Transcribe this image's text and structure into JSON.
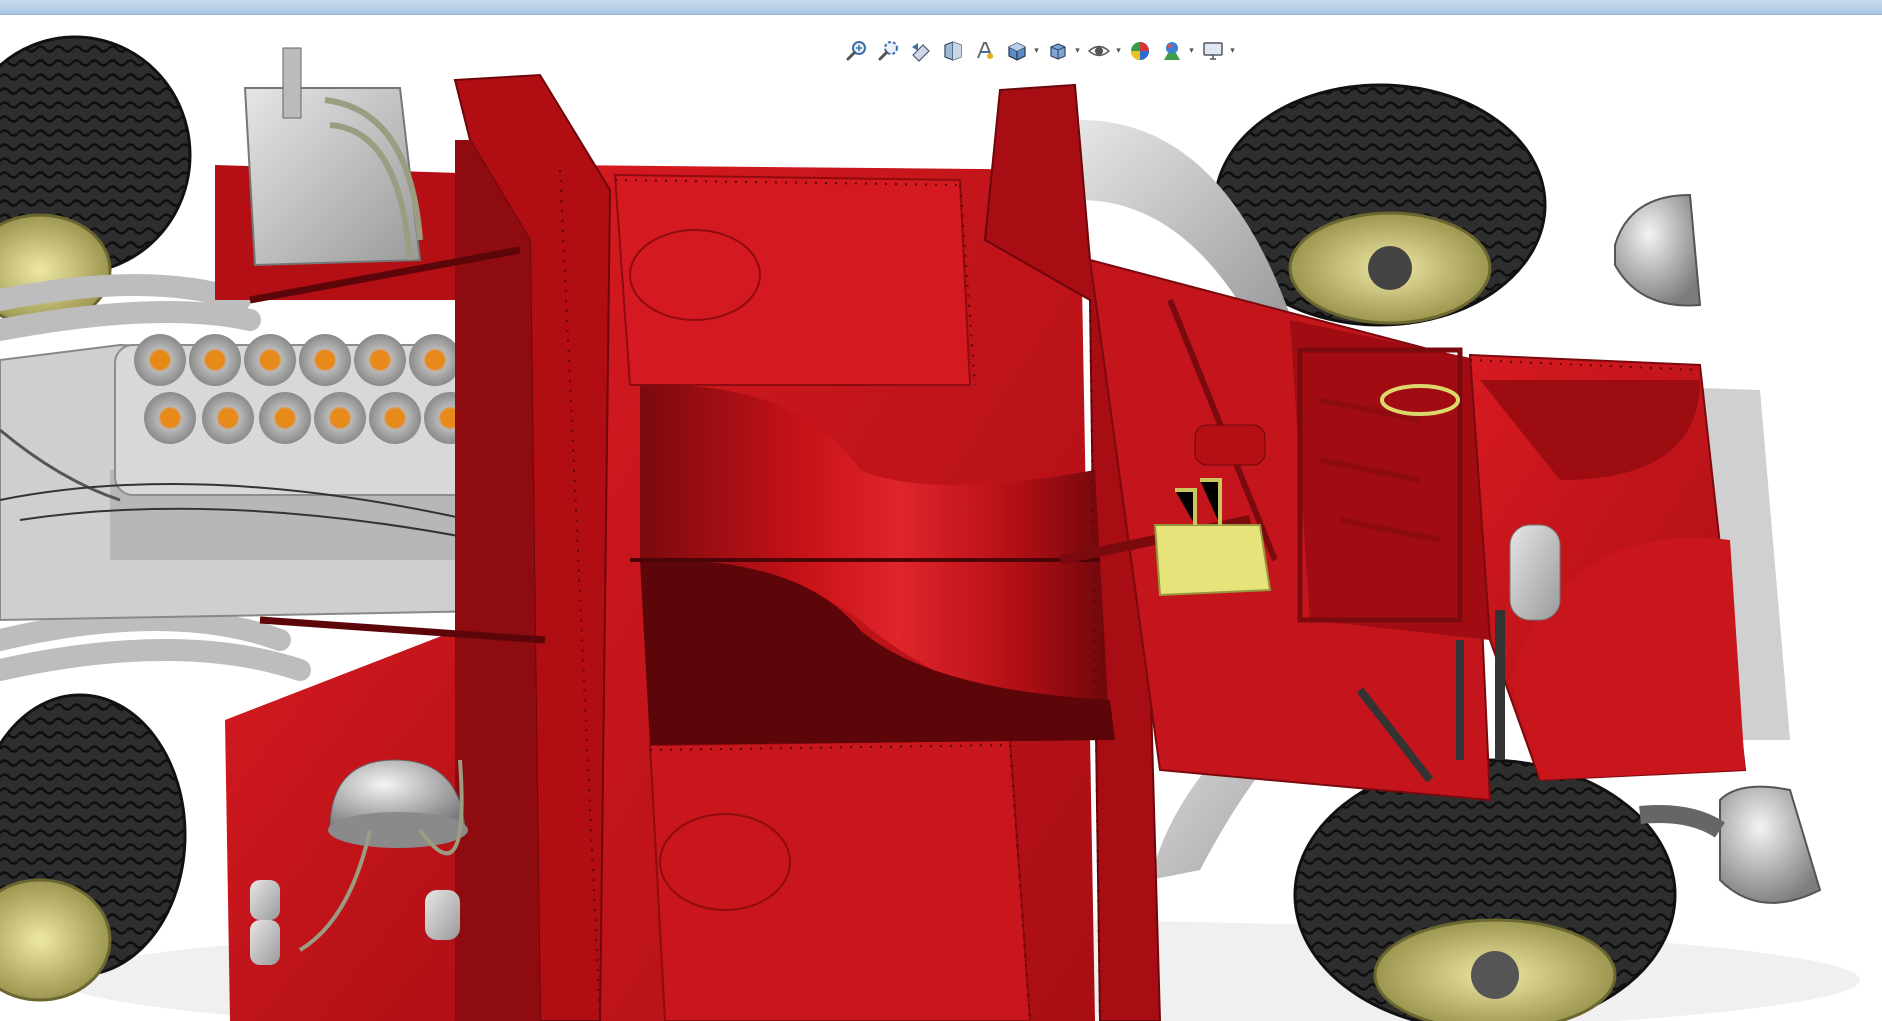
{
  "app": {
    "accent": "#a9c6e4",
    "viewport_background": "#ffffff"
  },
  "model": {
    "chassis_color": "#c8141a",
    "chassis_shadow": "#7a0a0e",
    "tire_color": "#2b2b2b",
    "rim_color": "#d9d58a",
    "engine_color": "#c9c9c9",
    "intake_color": "#e88a1a",
    "relay_color": "#e6e37a"
  },
  "toolbar": {
    "buttons": [
      {
        "icon": "zoom-to-fit-icon"
      },
      {
        "icon": "zoom-to-area-icon"
      },
      {
        "icon": "previous-view-icon"
      },
      {
        "icon": "section-view-icon"
      },
      {
        "icon": "dynamic-annotation-icon"
      },
      {
        "icon": "view-orientation-icon",
        "dropdown": true
      },
      {
        "icon": "display-style-icon",
        "dropdown": true
      },
      {
        "icon": "hide-show-items-icon",
        "dropdown": true
      },
      {
        "icon": "edit-appearance-icon"
      },
      {
        "icon": "apply-scene-icon",
        "dropdown": true
      },
      {
        "icon": "view-settings-icon",
        "dropdown": true
      }
    ]
  }
}
